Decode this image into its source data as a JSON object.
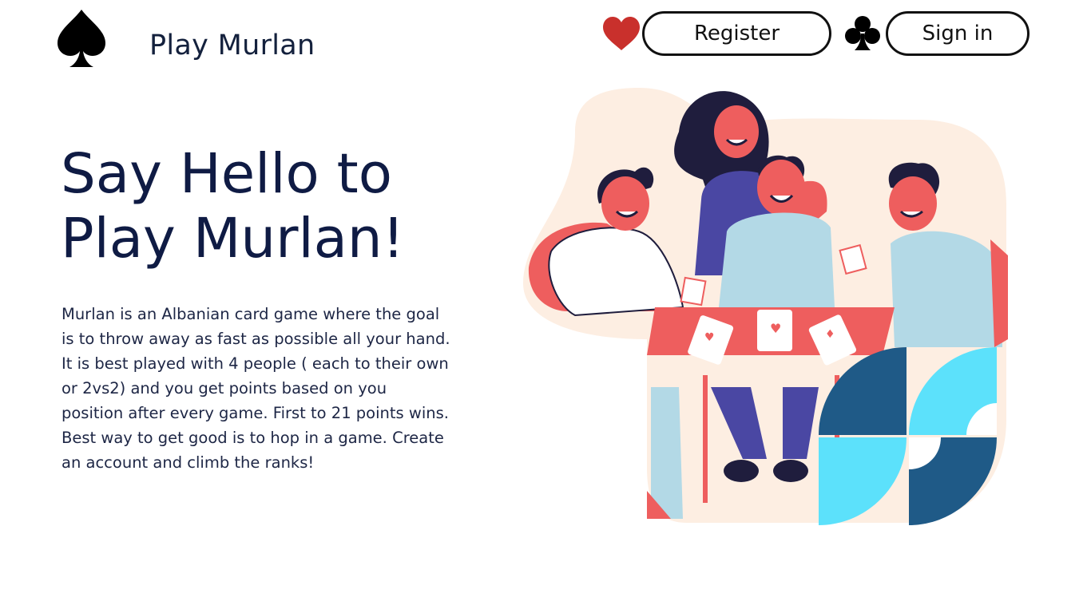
{
  "header": {
    "brand_name": "Play Murlan",
    "logo_icon": "spade-icon",
    "register_label": "Register",
    "signin_label": "Sign in",
    "register_icon": "heart-icon",
    "signin_icon": "club-icon"
  },
  "hero": {
    "title_line1": "Say Hello to",
    "title_line2": "Play Murlan!",
    "description": "Murlan is an Albanian card game where the goal is to throw away as fast as possible all your hand. It is best played with 4 people ( each to their own or 2vs2) and you get points based on you position after every game. First to 21 points wins. Best way to get good is to hop in a game. Create an account and climb the ranks!"
  },
  "illustration": {
    "icon": "people-playing-cards-illustration"
  },
  "colors": {
    "heading": "#0f1b44",
    "heart": "#c9302c",
    "coral": "#ee5e5e",
    "light_blue": "#b3d9e6",
    "navy": "#1f5a87",
    "cyan": "#5ce1fb",
    "purple": "#4a47a3",
    "cream": "#fdeee2"
  }
}
